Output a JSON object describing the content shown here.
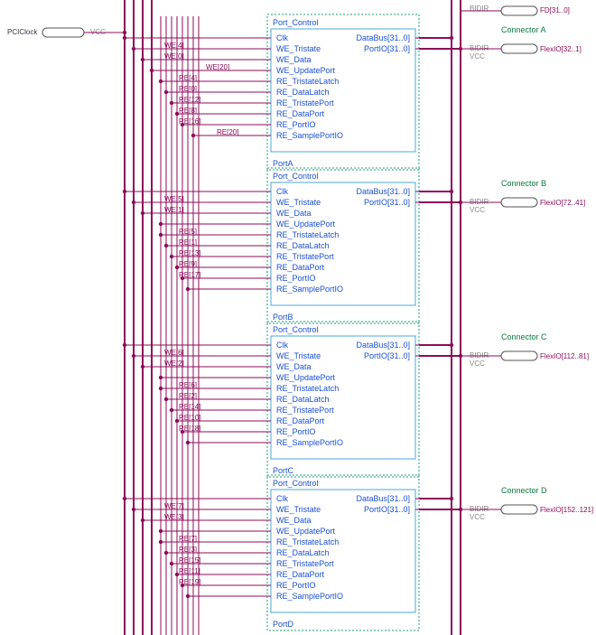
{
  "global": {
    "clock_label": "PCIClock",
    "vcc": "VCC",
    "bidir": "BIDIR",
    "fd_bus": "FD[31..0]"
  },
  "port_block": {
    "title": "Port_Control",
    "inputs": [
      "Clk",
      "WE_Tristate",
      "WE_Data",
      "WE_UpdatePort",
      "RE_TristateLatch",
      "RE_DataLatch",
      "RE_TristatePort",
      "RE_DataPort",
      "RE_PortIO",
      "RE_SamplePortIO"
    ],
    "outputs": [
      "DataBus[31..0]",
      "PortIO[31..0]"
    ]
  },
  "ports": [
    {
      "inst": "PortA",
      "connector": "Connector A",
      "flex": "FlexIO[32..1]",
      "we": [
        "WE[4]",
        "WE[0]"
      ],
      "we2": "WE[20]",
      "re": [
        "RE[4]",
        "RE[0]",
        "RE[12]",
        "RE[8]",
        "RE[16]"
      ],
      "re2": "RE[20]"
    },
    {
      "inst": "PortB",
      "connector": "Connector B",
      "flex": "FlexIO[72..41]",
      "we": [
        "WE[5]",
        "WE[1]"
      ],
      "we2": "",
      "re": [
        "RE[5]",
        "RE[1]",
        "RE[13]",
        "RE[9]",
        "RE[17]"
      ],
      "re2": ""
    },
    {
      "inst": "PortC",
      "connector": "Connector C",
      "flex": "FlexIO[112..81]",
      "we": [
        "WE[6]",
        "WE[2]"
      ],
      "we2": "",
      "re": [
        "RE[6]",
        "RE[2]",
        "RE[14]",
        "RE[10]",
        "RE[18]"
      ],
      "re2": ""
    },
    {
      "inst": "PortD",
      "connector": "Connector D",
      "flex": "FlexIO[152..121]",
      "we": [
        "WE[7]",
        "WE[3]"
      ],
      "we2": "",
      "re": [
        "RE[7]",
        "RE[3]",
        "RE[15]",
        "RE[11]",
        "RE[19]"
      ],
      "re2": ""
    }
  ]
}
